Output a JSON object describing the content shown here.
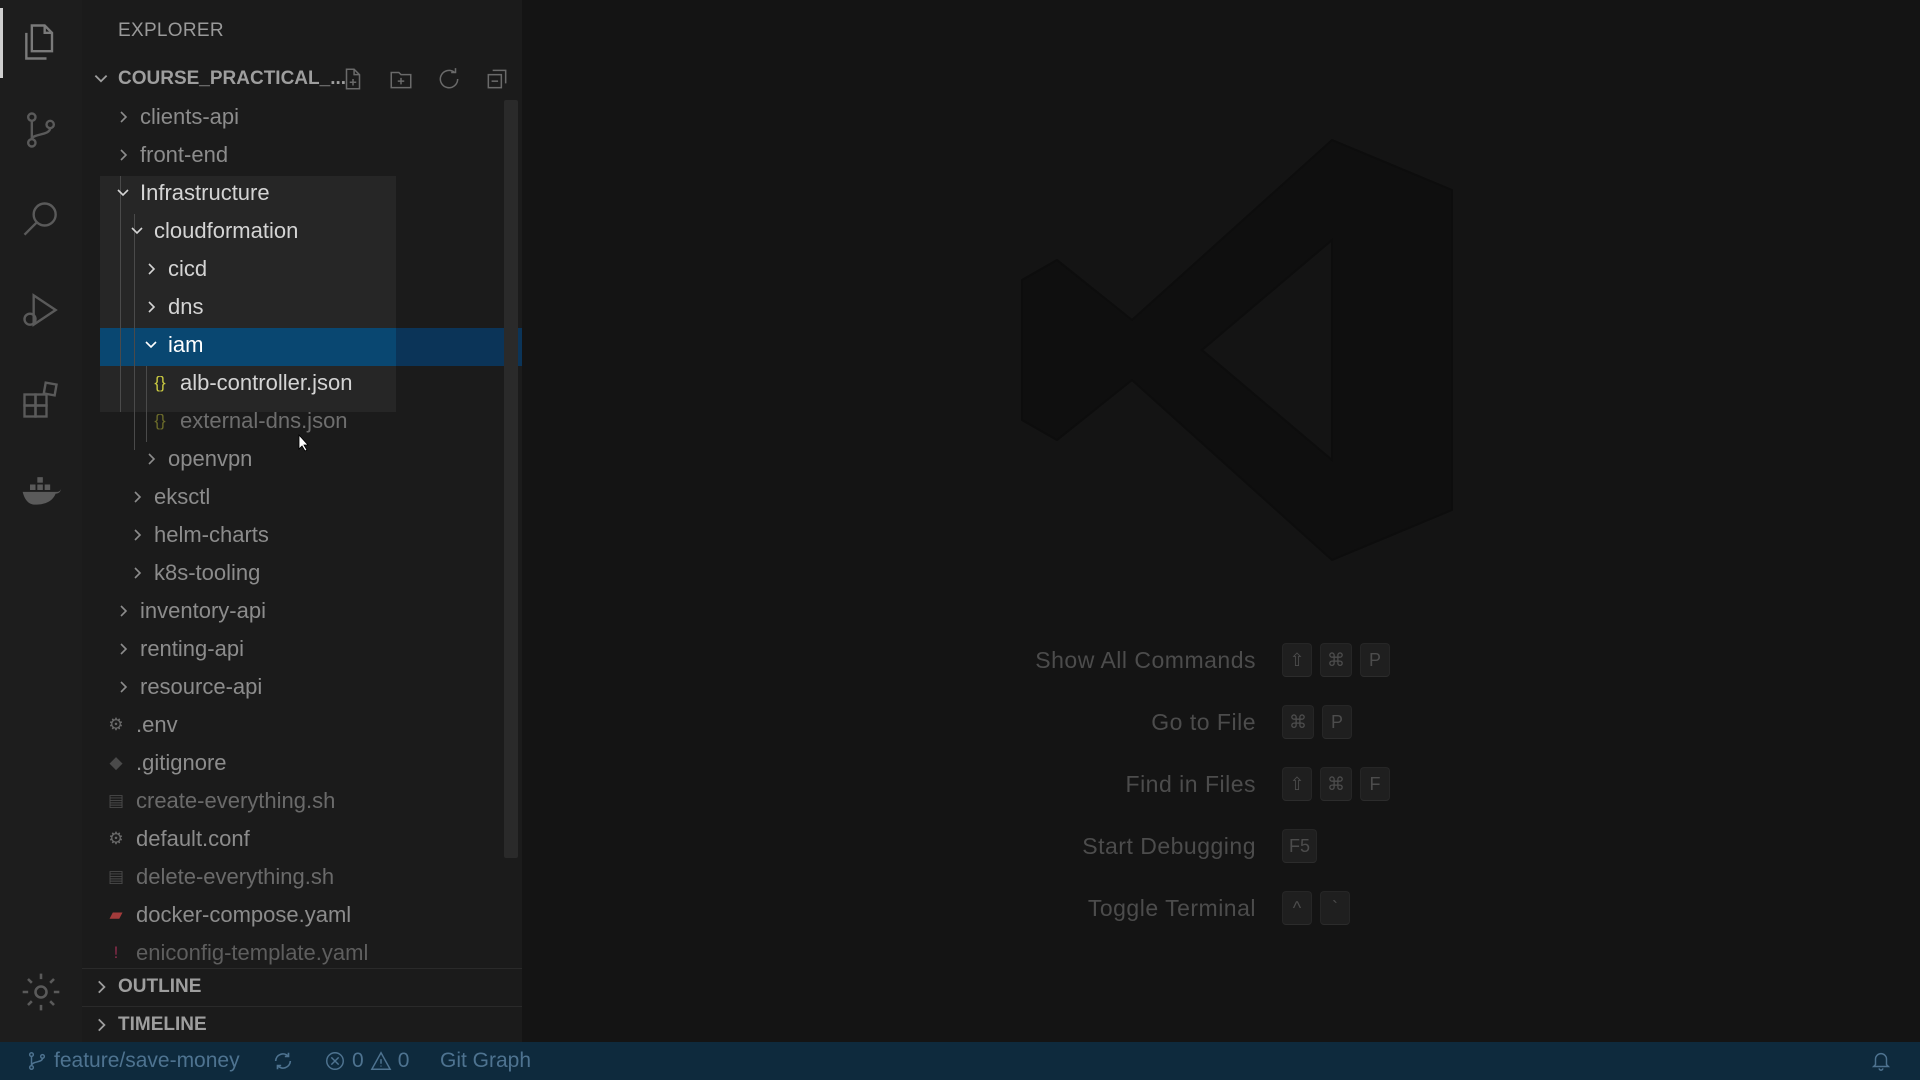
{
  "sidebar": {
    "title": "EXPLORER",
    "folder": "COURSE_PRACTICAL_...",
    "sections": {
      "outline": "OUTLINE",
      "timeline": "TIMELINE"
    },
    "tree": [
      {
        "label": "clients-api",
        "type": "folder",
        "expanded": false
      },
      {
        "label": "front-end",
        "type": "folder",
        "expanded": false
      },
      {
        "label": "Infrastructure",
        "type": "folder",
        "expanded": true
      },
      {
        "label": "cloudformation",
        "type": "folder",
        "expanded": true
      },
      {
        "label": "cicd",
        "type": "folder",
        "expanded": false
      },
      {
        "label": "dns",
        "type": "folder",
        "expanded": false
      },
      {
        "label": "iam",
        "type": "folder",
        "expanded": true
      },
      {
        "label": "alb-controller.json",
        "type": "json"
      },
      {
        "label": "external-dns.json",
        "type": "json"
      },
      {
        "label": "openvpn",
        "type": "folder",
        "expanded": false
      },
      {
        "label": "eksctl",
        "type": "folder",
        "expanded": false
      },
      {
        "label": "helm-charts",
        "type": "folder",
        "expanded": false
      },
      {
        "label": "k8s-tooling",
        "type": "folder",
        "expanded": false
      },
      {
        "label": "inventory-api",
        "type": "folder",
        "expanded": false
      },
      {
        "label": "renting-api",
        "type": "folder",
        "expanded": false
      },
      {
        "label": "resource-api",
        "type": "folder",
        "expanded": false
      },
      {
        "label": ".env",
        "type": "gear"
      },
      {
        "label": ".gitignore",
        "type": "git"
      },
      {
        "label": "create-everything.sh",
        "type": "shell"
      },
      {
        "label": "default.conf",
        "type": "gear"
      },
      {
        "label": "delete-everything.sh",
        "type": "shell"
      },
      {
        "label": "docker-compose.yaml",
        "type": "docker"
      },
      {
        "label": "eniconfig-template.yaml",
        "type": "yaml"
      }
    ]
  },
  "editor": {
    "shortcuts": [
      {
        "label": "Show All Commands",
        "keys": [
          "⇧",
          "⌘",
          "P"
        ]
      },
      {
        "label": "Go to File",
        "keys": [
          "⌘",
          "P"
        ]
      },
      {
        "label": "Find in Files",
        "keys": [
          "⇧",
          "⌘",
          "F"
        ]
      },
      {
        "label": "Start Debugging",
        "keys": [
          "F5"
        ]
      },
      {
        "label": "Toggle Terminal",
        "keys": [
          "^",
          "`"
        ]
      }
    ]
  },
  "statusbar": {
    "branch": "feature/save-money",
    "errors": "0",
    "warnings": "0",
    "git_graph": "Git Graph"
  },
  "colors": {
    "accent_selection": "#094771",
    "status_bar": "#0e2a3d",
    "json_icon": "#cbcb41",
    "docker_icon": "#e05252"
  }
}
